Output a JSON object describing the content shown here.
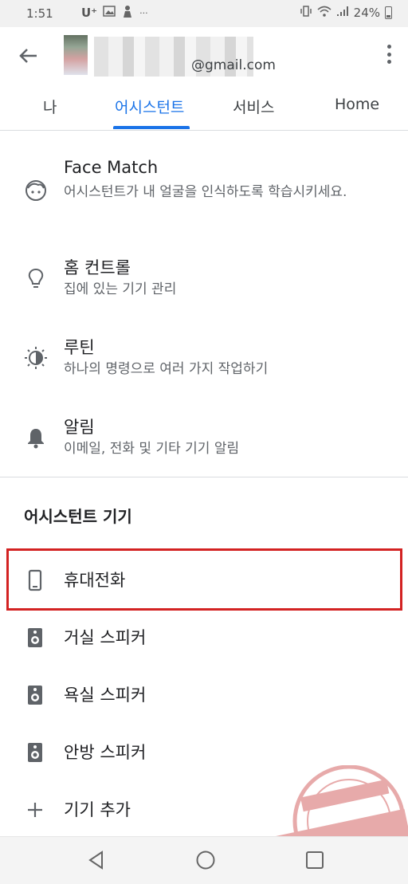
{
  "status_bar": {
    "time": "1:51",
    "carrier": "U⁺",
    "battery_percent": "24%"
  },
  "header": {
    "account_email": "@gmail.com",
    "tabs": [
      {
        "label": "나"
      },
      {
        "label": "어시스턴트"
      },
      {
        "label": "서비스"
      },
      {
        "label": "Home"
      }
    ],
    "active_tab_index": 1
  },
  "settings": [
    {
      "icon": "face-icon",
      "title": "Face Match",
      "subtitle": "어시스턴트가 내 얼굴을 인식하도록 학습시키세요."
    },
    {
      "icon": "lightbulb-icon",
      "title": "홈 컨트롤",
      "subtitle": "집에 있는 기기 관리"
    },
    {
      "icon": "routine-icon",
      "title": "루틴",
      "subtitle": "하나의 명령으로 여러 가지 작업하기"
    },
    {
      "icon": "bell-icon",
      "title": "알림",
      "subtitle": "이메일, 전화 및 기타 기기 알림"
    }
  ],
  "devices_section": {
    "title": "어시스턴트 기기",
    "items": [
      {
        "icon": "phone-icon",
        "label": "휴대전화"
      },
      {
        "icon": "speaker-icon",
        "label": "거실 스피커"
      },
      {
        "icon": "speaker-icon",
        "label": "욕실 스피커"
      },
      {
        "icon": "speaker-icon",
        "label": "안방 스피커"
      },
      {
        "icon": "plus-icon",
        "label": "기기 추가"
      }
    ]
  },
  "colors": {
    "accent": "#1a73e8",
    "highlight_border": "#d32222",
    "icon_gray": "#5f6368"
  }
}
